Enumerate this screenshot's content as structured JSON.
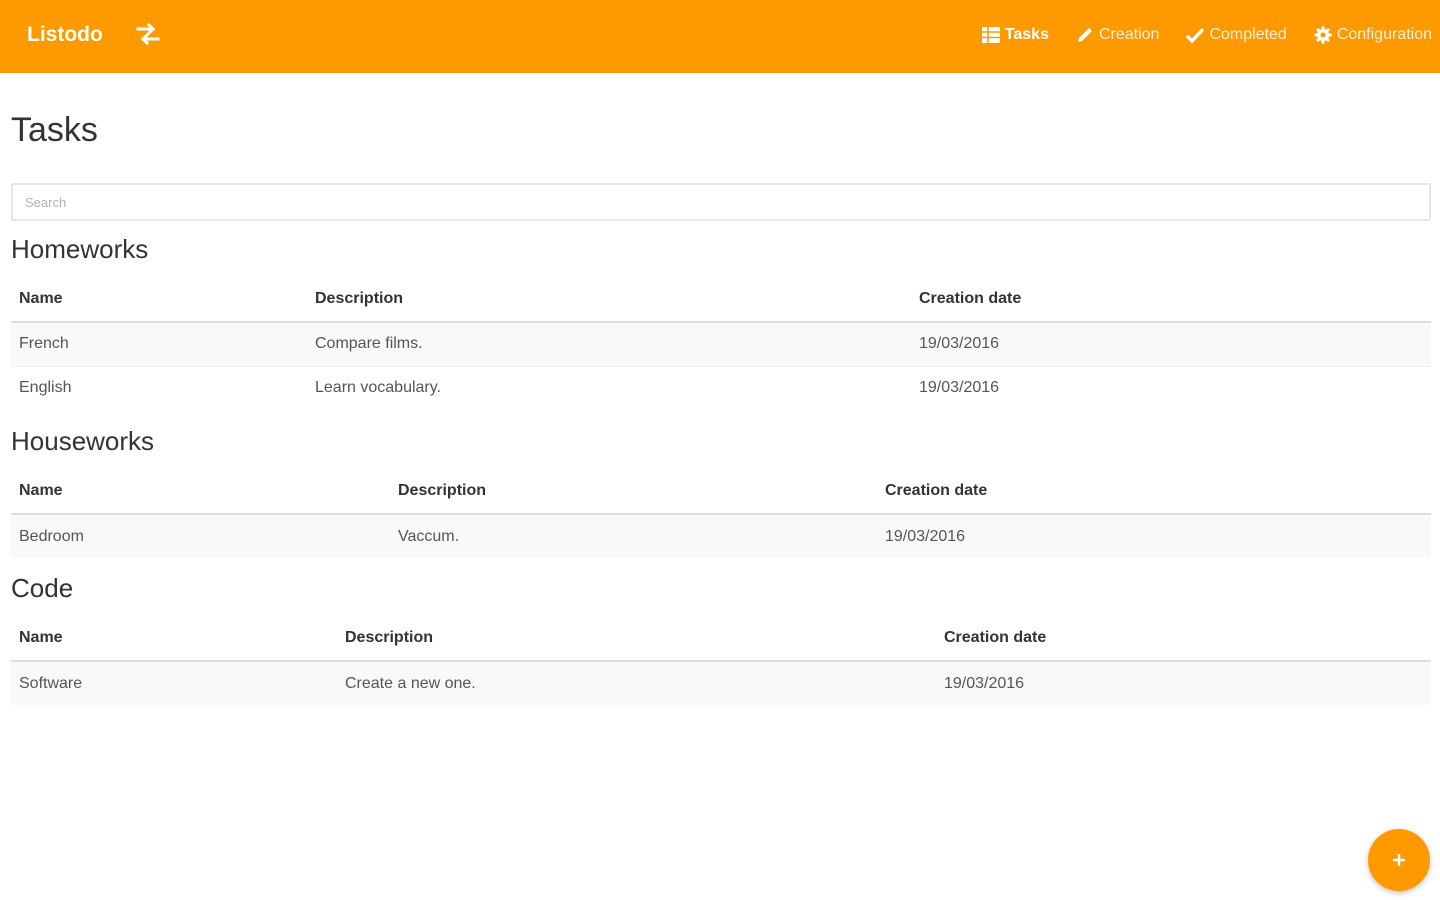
{
  "colors": {
    "accent": "#ff9900",
    "nav_text": "#ffffff"
  },
  "navbar": {
    "brand": "Listodo",
    "swap_icon": "swap-arrows-icon",
    "links": [
      {
        "label": "Tasks",
        "icon": "table-icon",
        "active": true
      },
      {
        "label": "Creation",
        "icon": "pencil-icon",
        "active": false
      },
      {
        "label": "Completed",
        "icon": "check-icon",
        "active": false
      },
      {
        "label": "Configuration",
        "icon": "gear-icon",
        "active": false
      }
    ]
  },
  "main": {
    "title": "Tasks",
    "search": {
      "placeholder": "Search",
      "value": ""
    },
    "groups": [
      {
        "title": "Homeworks",
        "columns": [
          "Name",
          "Description",
          "Creation date"
        ],
        "rows": [
          {
            "name": "French",
            "description": "Compare films.",
            "date": "19/03/2016"
          },
          {
            "name": "English",
            "description": "Learn vocabulary.",
            "date": "19/03/2016"
          }
        ]
      },
      {
        "title": "Houseworks",
        "columns": [
          "Name",
          "Description",
          "Creation date"
        ],
        "rows": [
          {
            "name": "Bedroom",
            "description": "Vaccum.",
            "date": "19/03/2016"
          }
        ]
      },
      {
        "title": "Code",
        "columns": [
          "Name",
          "Description",
          "Creation date"
        ],
        "rows": [
          {
            "name": "Software",
            "description": "Create a new one.",
            "date": "19/03/2016"
          }
        ]
      }
    ]
  },
  "fab": {
    "icon": "plus-icon"
  }
}
